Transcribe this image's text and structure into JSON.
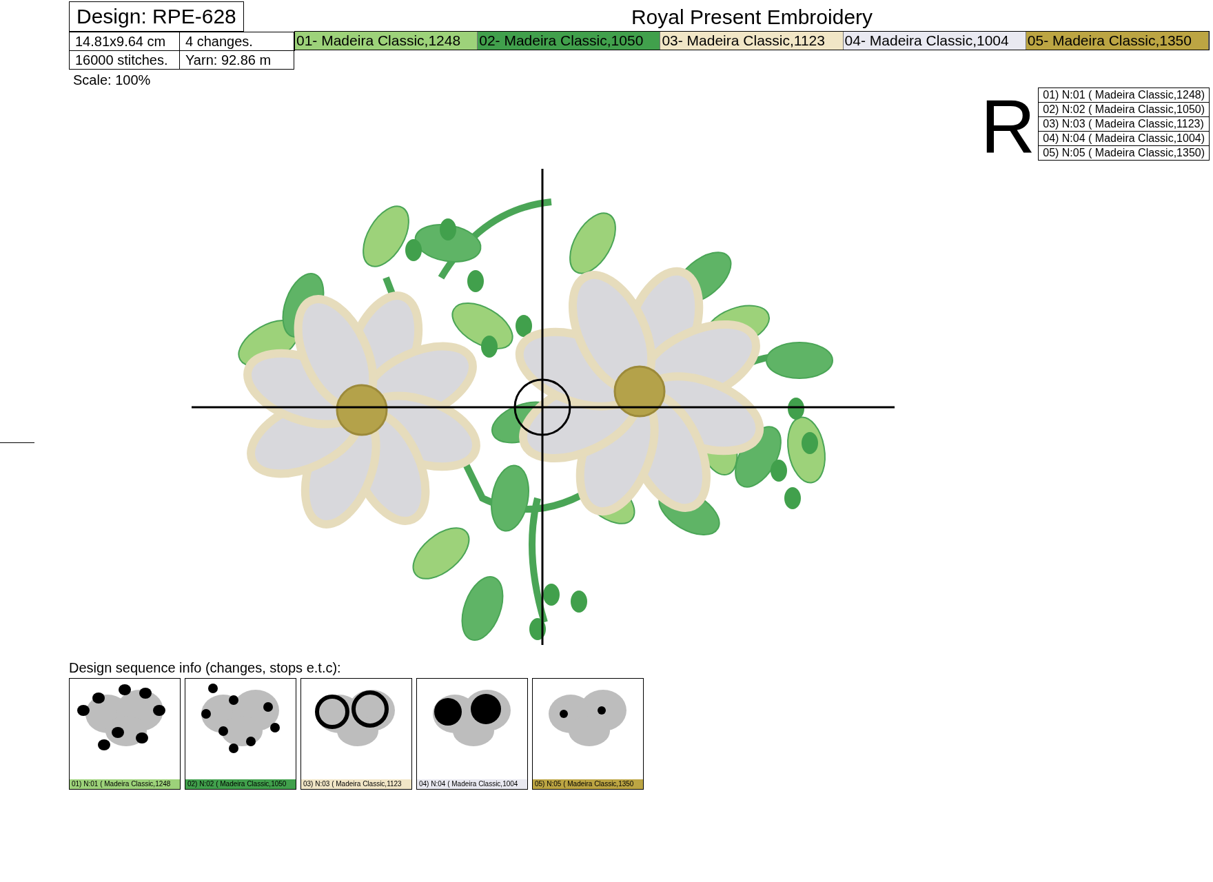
{
  "design": {
    "title": "Design: RPE-628",
    "size": "14.81x9.64 cm",
    "changes": "4 changes.",
    "stitches": "16000 stitches.",
    "yarn": "Yarn: 92.86 m",
    "scale": "Scale: 100%"
  },
  "brand": "Royal Present Embroidery",
  "colors": [
    {
      "label": "01- Madeira Classic,1248",
      "color": "#9dd27a"
    },
    {
      "label": "02- Madeira Classic,1050",
      "color": "#41a04c"
    },
    {
      "label": "03- Madeira Classic,1123",
      "color": "#f1e6c6"
    },
    {
      "label": "04- Madeira Classic,1004",
      "color": "#e9e9f1"
    },
    {
      "label": "05- Madeira Classic,1350",
      "color": "#bca543"
    }
  ],
  "logo_letter": "R",
  "legend": [
    "01) N:01 ( Madeira Classic,1248)",
    "02) N:02 ( Madeira Classic,1050)",
    "03) N:03 ( Madeira Classic,1123)",
    "04) N:04 ( Madeira Classic,1004)",
    "05) N:05 ( Madeira Classic,1350)"
  ],
  "sequence": {
    "heading": "Design sequence info (changes, stops e.t.c):",
    "steps": [
      {
        "label": "01) N:01 ( Madeira Classic,1248",
        "color": "#9dd27a"
      },
      {
        "label": "02) N:02 ( Madeira Classic,1050",
        "color": "#41a04c"
      },
      {
        "label": "03) N:03 ( Madeira Classic,1123",
        "color": "#f1e6c6"
      },
      {
        "label": "04) N:04 ( Madeira Classic,1004",
        "color": "#e9e9f1"
      },
      {
        "label": "05) N:05 ( Madeira Classic,1350",
        "color": "#bca543"
      }
    ]
  }
}
